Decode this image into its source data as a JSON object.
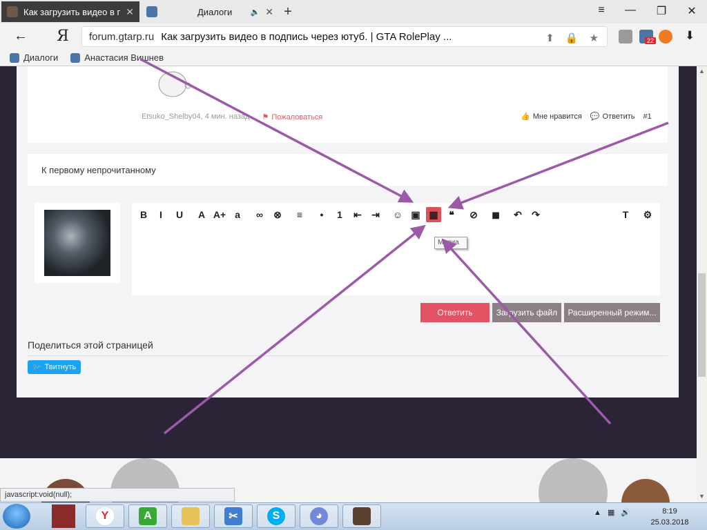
{
  "browser": {
    "tabs": [
      {
        "title": "Как загрузить видео в по",
        "active": true
      },
      {
        "title": "Диалоги",
        "active": false
      }
    ],
    "address": {
      "domain": "forum.gtarp.ru",
      "title": "Как загрузить видео в подпись через ютуб. | GTA RolePlay ..."
    },
    "brand_letter": "Я",
    "extension_badge": "22",
    "bookmarks": [
      {
        "label": "Диалоги"
      },
      {
        "label": "Анастасия Вишнев"
      }
    ]
  },
  "post": {
    "author_time": "Etsuko_Shelby04, 4 мин. назад",
    "report_label": "Пожаловаться",
    "like_label": "Мне нравится",
    "reply_label": "Ответить",
    "post_number": "#1"
  },
  "unread_link": "К первому непрочитанному",
  "editor": {
    "toolbar": [
      {
        "name": "bold",
        "glyph": "B"
      },
      {
        "name": "italic",
        "glyph": "I"
      },
      {
        "name": "underline",
        "glyph": "U"
      },
      {
        "name": "text-color",
        "glyph": "A"
      },
      {
        "name": "font-size",
        "glyph": "A+"
      },
      {
        "name": "font-family",
        "glyph": "a"
      },
      {
        "name": "link",
        "glyph": "∞"
      },
      {
        "name": "unlink",
        "glyph": "⊗"
      },
      {
        "name": "align",
        "glyph": "≡"
      },
      {
        "name": "bullet-list",
        "glyph": "•"
      },
      {
        "name": "number-list",
        "glyph": "1"
      },
      {
        "name": "outdent",
        "glyph": "⇤"
      },
      {
        "name": "indent",
        "glyph": "⇥"
      },
      {
        "name": "smilies",
        "glyph": "☺"
      },
      {
        "name": "image",
        "glyph": "▣"
      },
      {
        "name": "media",
        "glyph": "▦"
      },
      {
        "name": "quote",
        "glyph": "❝"
      },
      {
        "name": "spoiler",
        "glyph": "⊘"
      },
      {
        "name": "save-draft",
        "glyph": "◼"
      },
      {
        "name": "undo",
        "glyph": "↶"
      },
      {
        "name": "redo",
        "glyph": "↷"
      },
      {
        "name": "remove-format",
        "glyph": "T"
      },
      {
        "name": "toggle-bbcode",
        "glyph": "⚙"
      }
    ],
    "tooltip": "Медиа"
  },
  "buttons": {
    "reply": "Ответить",
    "upload": "Загрузить файл",
    "advanced": "Расширенный режим..."
  },
  "share": {
    "title": "Поделиться этой страницей",
    "tweet": "Твитнуть"
  },
  "statusbar": "javascript:void(null);",
  "taskbar": {
    "time": "8:19",
    "date": "25.03.2018"
  },
  "colors": {
    "accent_red": "#e45363",
    "arrow_purple": "#9b59a8",
    "page_dark": "#2b2436",
    "twitter_blue": "#1da1f2"
  }
}
